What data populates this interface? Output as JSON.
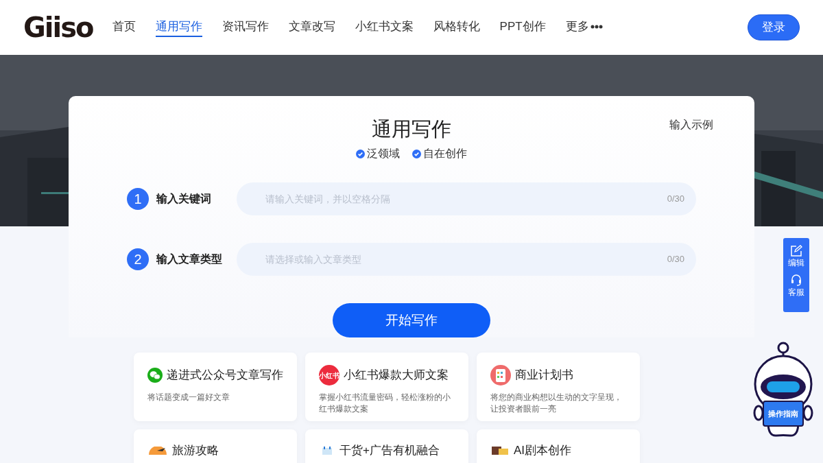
{
  "header": {
    "logo": "Giiso",
    "nav": [
      {
        "label": "首页",
        "selected": false
      },
      {
        "label": "通用写作",
        "selected": true
      },
      {
        "label": "资讯写作",
        "selected": false
      },
      {
        "label": "文章改写",
        "selected": false
      },
      {
        "label": "小红书文案",
        "selected": false
      },
      {
        "label": "风格转化",
        "selected": false
      },
      {
        "label": "PPT创作",
        "selected": false
      },
      {
        "label": "更多",
        "selected": false,
        "kind": "more"
      }
    ],
    "login": "登录"
  },
  "panel": {
    "title": "通用写作",
    "example_link": "输入示例",
    "features": [
      "泛领域",
      "自在创作"
    ],
    "steps": [
      {
        "number": "1",
        "label": "输入关键词",
        "placeholder": "请输入关键词，并以空格分隔",
        "counter": "0/30"
      },
      {
        "number": "2",
        "label": "输入文章类型",
        "placeholder": "请选择或输入文章类型",
        "counter": "0/30"
      }
    ],
    "start_button": "开始写作"
  },
  "templates": [
    {
      "kind": "wechat",
      "title": "递进式公众号文章写作",
      "description": "将话题变成一篇好文章"
    },
    {
      "kind": "xhs",
      "icon_text": "小红书",
      "title": "小红书爆款大师文案",
      "description": "掌握小红书流量密码，轻松涨粉的小红书爆款文案"
    },
    {
      "kind": "plan",
      "title": "商业计划书",
      "description": "将您的商业构想以生动的文字呈现，让投资者眼前一亮"
    },
    {
      "kind": "travel",
      "title": "旅游攻略"
    },
    {
      "kind": "ad",
      "title": "干货+广告有机融合"
    },
    {
      "kind": "script",
      "title": "AI剧本创作"
    }
  ],
  "side_tools": [
    {
      "kind": "edit",
      "label": "编辑"
    },
    {
      "kind": "service",
      "label": "客服"
    }
  ],
  "guide": {
    "label": "操作指南"
  }
}
